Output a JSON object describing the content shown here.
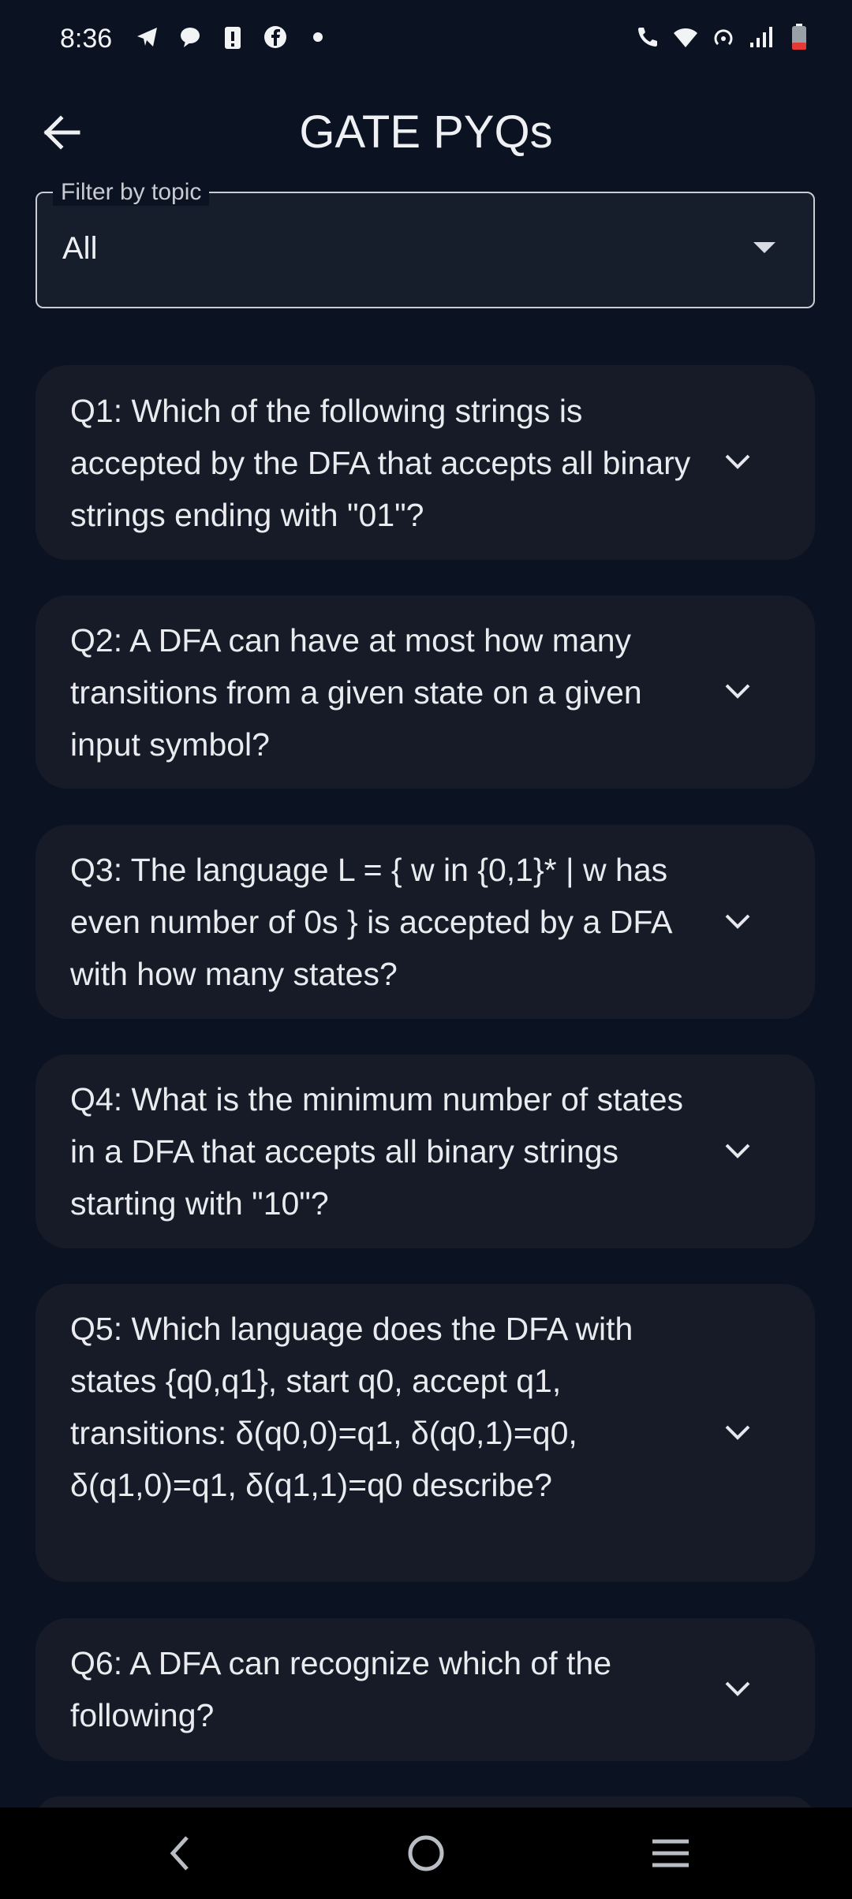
{
  "status_bar": {
    "time": "8:36",
    "left_icons": [
      "telegram-icon",
      "chat-bubble-icon",
      "battery-alert-icon",
      "facebook-icon",
      "dot-icon"
    ],
    "right_icons": [
      "wifi-call-icon",
      "wifi-icon",
      "hotspot-icon",
      "signal-icon",
      "battery-icon"
    ]
  },
  "app_bar": {
    "title": "GATE PYQs",
    "back_icon": "arrow-left-icon"
  },
  "filter": {
    "label": "Filter by topic",
    "value": "All"
  },
  "questions": [
    {
      "text": "Q1: Which of the following strings is accepted by the DFA that accepts all binary strings ending with \"01\"?"
    },
    {
      "text": "Q2: A DFA can have at most how many transitions from a given state on a given input symbol?"
    },
    {
      "text": "Q3: The language L = { w in {0,1}* | w has even number of 0s } is accepted by a DFA with how many states?"
    },
    {
      "text": "Q4: What is the minimum number of states in a DFA that accepts all binary strings starting with \"10\"?"
    },
    {
      "text": "Q5: Which language does the DFA with states {q0,q1}, start q0, accept q1, transitions: δ(q0,0)=q1, δ(q0,1)=q0, δ(q1,0)=q1, δ(q1,1)=q0 describe?"
    },
    {
      "text": "Q6: A DFA can recognize which of the following?"
    }
  ],
  "nav_bar": {
    "back_icon": "nav-back-icon",
    "home_icon": "nav-home-icon",
    "recents_icon": "nav-recents-icon"
  },
  "colors": {
    "background": "#0b1221",
    "card": "#161b27",
    "text": "#e9ebef"
  }
}
